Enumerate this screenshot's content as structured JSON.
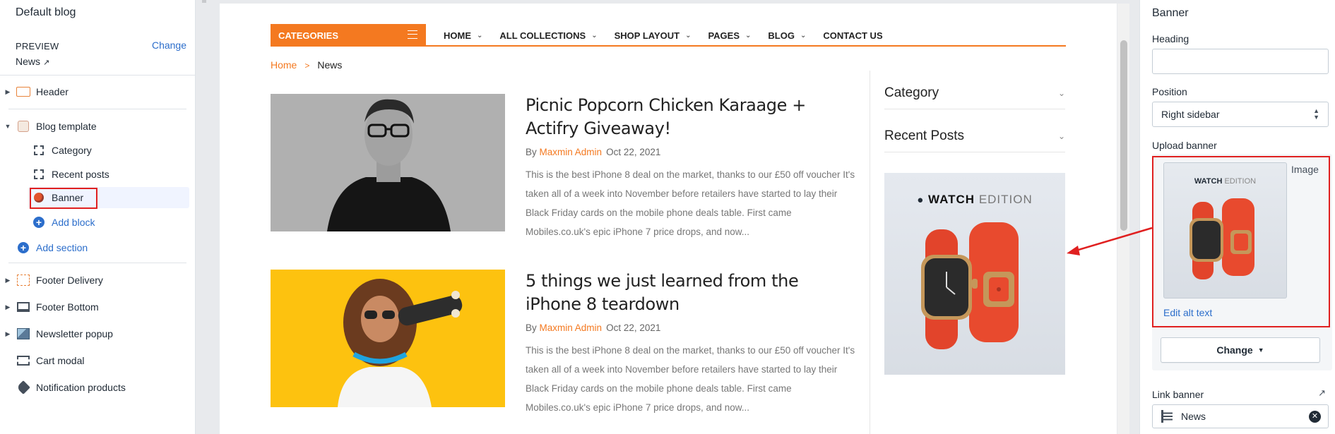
{
  "left": {
    "title": "Default blog",
    "preview_label": "PREVIEW",
    "preview_change": "Change",
    "preview_value": "News",
    "items": [
      {
        "label": "Header"
      },
      {
        "label": "Blog template"
      },
      {
        "label": "Category"
      },
      {
        "label": "Recent posts"
      },
      {
        "label": "Banner"
      },
      {
        "label": "Add block"
      },
      {
        "label": "Add section"
      },
      {
        "label": "Footer Delivery"
      },
      {
        "label": "Footer Bottom"
      },
      {
        "label": "Newsletter popup"
      },
      {
        "label": "Cart modal"
      },
      {
        "label": "Notification products"
      }
    ]
  },
  "site": {
    "categories_label": "CATEGORIES",
    "nav": [
      {
        "label": "HOME",
        "dropdown": true
      },
      {
        "label": "ALL COLLECTIONS",
        "dropdown": true
      },
      {
        "label": "SHOP LAYOUT",
        "dropdown": true
      },
      {
        "label": "PAGES",
        "dropdown": true
      },
      {
        "label": "BLOG",
        "dropdown": true
      },
      {
        "label": "CONTACT US",
        "dropdown": false
      }
    ],
    "breadcrumb": {
      "home": "Home",
      "separator": ">",
      "current": "News"
    },
    "posts": [
      {
        "title": "Picnic Popcorn Chicken Karaage + Actifry Giveaway!",
        "by": "By",
        "author": "Maxmin Admin",
        "date": "Oct 22, 2021",
        "excerpt": "This is the best iPhone 8 deal on the market, thanks to our £50 off voucher It's taken all of a week into November before retailers have started to lay their Black Friday cards on the mobile phone deals table. First came Mobiles.co.uk's epic iPhone 7 price drops, and now..."
      },
      {
        "title": "5 things we just learned from the iPhone 8 teardown",
        "by": "By",
        "author": "Maxmin Admin",
        "date": "Oct 22, 2021",
        "excerpt": "This is the best iPhone 8 deal on the market, thanks to our £50 off voucher It's taken all of a week into November before retailers have started to lay their Black Friday cards on the mobile phone deals table. First came Mobiles.co.uk's epic iPhone 7 price drops, and now..."
      }
    ],
    "sidebar": {
      "category": "Category",
      "recent_posts": "Recent Posts",
      "banner_text_bold": "WATCH",
      "banner_text_light": "EDITION"
    }
  },
  "right": {
    "title": "Banner",
    "heading_label": "Heading",
    "heading_value": "",
    "position_label": "Position",
    "position_value": "Right sidebar",
    "upload_label": "Upload banner",
    "image_label": "Image",
    "edit_alt": "Edit alt text",
    "change_btn": "Change",
    "link_label": "Link banner",
    "link_value": "News"
  },
  "colors": {
    "accent": "#f47920",
    "admin_link": "#2c6ecb",
    "highlight": "#e02020"
  }
}
